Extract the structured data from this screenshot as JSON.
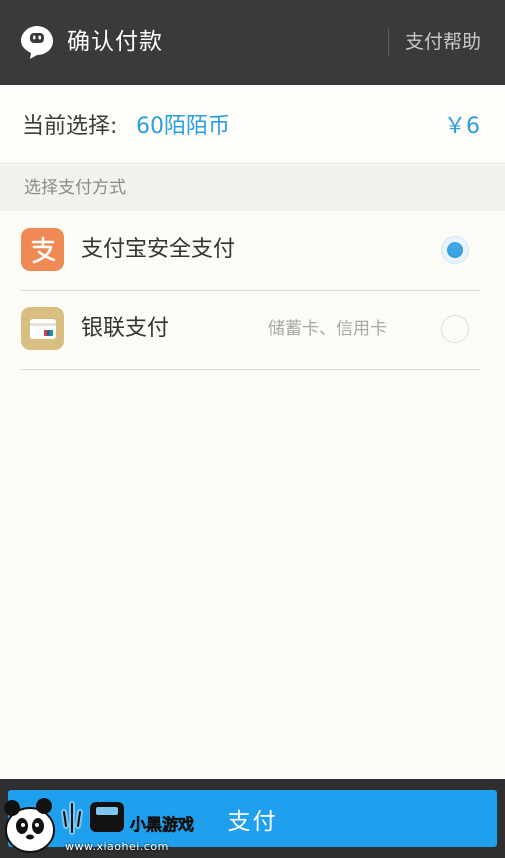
{
  "header": {
    "title": "确认付款",
    "help_label": "支付帮助",
    "logo_icon": "momo-chat-bubble-icon"
  },
  "current": {
    "label": "当前选择:",
    "item": "60陌陌币",
    "price": "￥6"
  },
  "section_title": "选择支付方式",
  "options": [
    {
      "label": "支付宝安全支付",
      "sub": "",
      "icon": "alipay-icon",
      "icon_color": "#f08a55",
      "selected": true
    },
    {
      "label": "银联支付",
      "sub": "储蓄卡、信用卡",
      "icon": "unionpay-card-icon",
      "icon_color": "#d9be82",
      "selected": false
    }
  ],
  "pay_button": {
    "label": "支付"
  },
  "watermark": {
    "brand": "小黑游戏",
    "url": "www.xiaohei.com"
  },
  "colors": {
    "accent": "#2a9fe0",
    "button": "#1fa0ef",
    "header_bg": "#3a3a3a"
  }
}
